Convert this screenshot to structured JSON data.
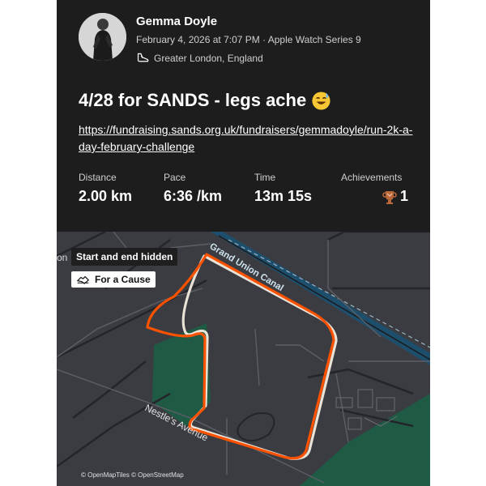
{
  "activity": {
    "athlete_name": "Gemma Doyle",
    "meta": "February 4, 2026 at 7:07 PM · Apple Watch Series 9",
    "location": "Greater London, England",
    "activity_type_icon": "shoe-icon",
    "title": "4/28 for SANDS - legs ache",
    "title_emoji": "sweat-smile-emoji",
    "description_link": "https://fundraising.sands.org.uk/fundraisers/gemmadoyle/run-2k-a-day-february-challenge"
  },
  "stats": {
    "distance": {
      "label": "Distance",
      "value": "2.00 km"
    },
    "pace": {
      "label": "Pace",
      "value": "6:36 /km"
    },
    "time": {
      "label": "Time",
      "value": "13m 15s"
    },
    "achievements": {
      "label": "Achievements",
      "value": "1",
      "icon": "trophy-icon"
    }
  },
  "map": {
    "hidden_label": "Start and end hidden",
    "cause_label": "For a Cause",
    "cause_icon": "handshake-icon",
    "attribution": "© OpenMapTiles © OpenStreetMap",
    "edge_text": "on",
    "canal_label": "Grand Union Canal",
    "street_label": "Nestle's Avenue",
    "route_color": "#fc5200"
  },
  "colors": {
    "card_background": "#1d1d1d",
    "map_background": "#3a3c42",
    "water": "#1d4f6d",
    "park": "#1f5a44"
  }
}
